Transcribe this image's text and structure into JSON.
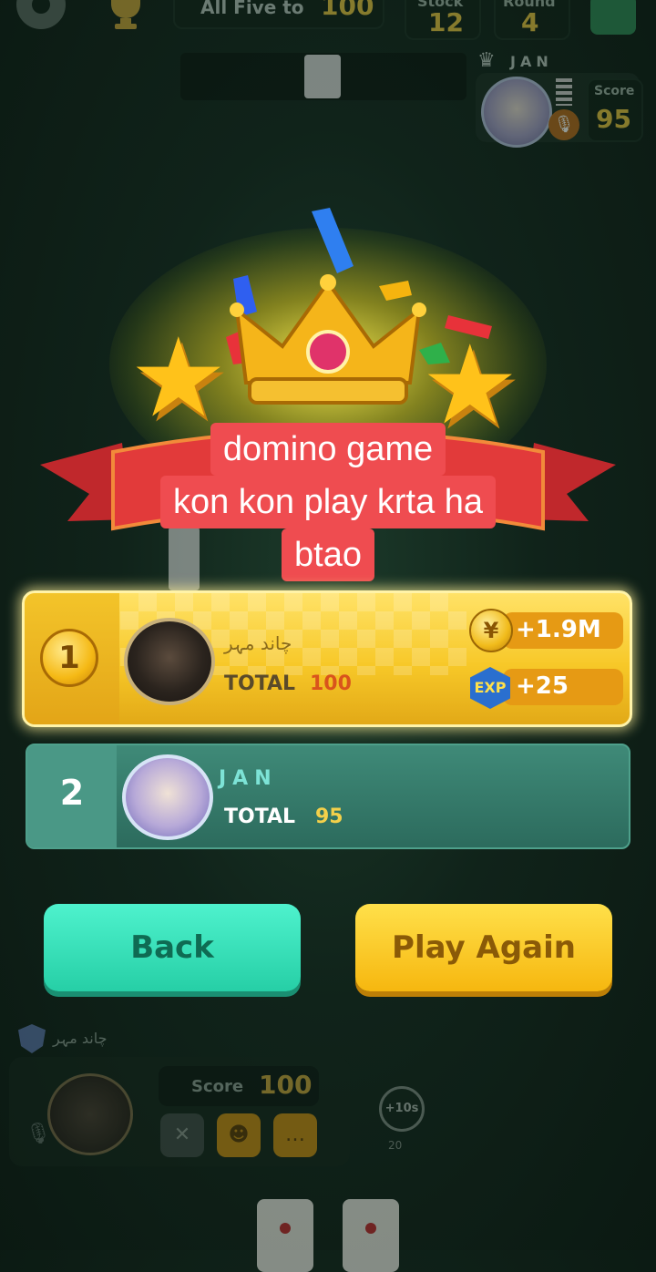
{
  "top_bar": {
    "goal_label": "All Five to",
    "goal_value": "100",
    "stock_label": "Stock",
    "stock_value": "12",
    "round_label": "Round",
    "round_value": "4"
  },
  "opponent": {
    "name": "JAN",
    "score_label": "Score",
    "score_value": "95"
  },
  "caption": {
    "lines": [
      "domino game",
      "kon kon play krta ha",
      "btao"
    ]
  },
  "results": [
    {
      "rank": "1",
      "name": "چاند مہر",
      "total_label": "TOTAL",
      "total_value": "100",
      "coins": "+1.9M",
      "exp_label": "EXP",
      "exp": "+25"
    },
    {
      "rank": "2",
      "name": "JAN",
      "total_label": "TOTAL",
      "total_value": "95"
    }
  ],
  "buttons": {
    "back": "Back",
    "play_again": "Play Again"
  },
  "player": {
    "name": "چاند مہر",
    "score_label": "Score",
    "score_value": "100",
    "timer_label": "+10s",
    "timer_sub": "20"
  },
  "colors": {
    "winner_row": "#f7c828",
    "loser_row": "#2c6b5d",
    "back_button": "#26cfa6",
    "play_button": "#f6b70f",
    "caption_bg": "#ef4c50"
  }
}
